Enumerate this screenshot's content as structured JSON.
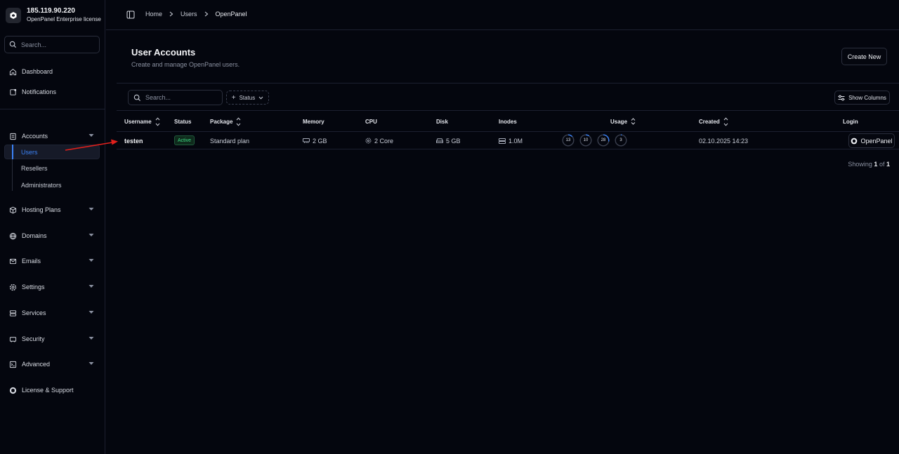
{
  "brand": {
    "ip": "185.119.90.220",
    "license": "OpenPanel Enterprise license"
  },
  "sidebar": {
    "search_placeholder": "Search...",
    "top_items": [
      {
        "label": "Dashboard",
        "icon": "home-icon"
      },
      {
        "label": "Notifications",
        "icon": "notification-icon"
      }
    ],
    "accounts": {
      "label": "Accounts",
      "icon": "accounts-icon",
      "children": [
        "Users",
        "Resellers",
        "Administrators"
      ],
      "active_child": "Users"
    },
    "sections": [
      {
        "label": "Hosting Plans",
        "icon": "package-icon"
      },
      {
        "label": "Domains",
        "icon": "globe-icon"
      },
      {
        "label": "Emails",
        "icon": "mail-icon"
      },
      {
        "label": "Settings",
        "icon": "gear-icon"
      },
      {
        "label": "Services",
        "icon": "server-icon"
      },
      {
        "label": "Security",
        "icon": "security-icon"
      },
      {
        "label": "Advanced",
        "icon": "terminal-icon"
      }
    ],
    "license_support": "License & Support"
  },
  "breadcrumb": [
    "Home",
    "Users",
    "OpenPanel"
  ],
  "page": {
    "title": "User Accounts",
    "subtitle": "Create and manage OpenPanel users.",
    "create_button": "Create New"
  },
  "toolbar": {
    "search_placeholder": "Search...",
    "status_filter": "Status",
    "show_columns": "Show Columns"
  },
  "table": {
    "headers": {
      "username": "Username",
      "status": "Status",
      "package": "Package",
      "memory": "Memory",
      "cpu": "CPU",
      "disk": "Disk",
      "inodes": "Inodes",
      "usage": "Usage",
      "created": "Created",
      "login": "Login"
    },
    "rows": [
      {
        "username": "testen",
        "status": "Active",
        "package": "Standard plan",
        "memory": "2 GB",
        "cpu": "2 Core",
        "disk": "5 GB",
        "inodes": "1.0M",
        "usage": [
          {
            "label": "13",
            "percent": 13
          },
          {
            "label": "10",
            "percent": 10
          },
          {
            "label": "28",
            "percent": 28
          },
          {
            "label": "3",
            "percent": 3
          }
        ],
        "created": "02.10.2025 14:23",
        "login": "OpenPanel"
      }
    ]
  },
  "pagination": {
    "showing_word": "Showing",
    "page": "1",
    "of_word": "of",
    "total": "1"
  },
  "colors": {
    "accent": "#3b82f6",
    "status_active": "#3ddc84",
    "annotation_arrow": "#e0201c"
  }
}
